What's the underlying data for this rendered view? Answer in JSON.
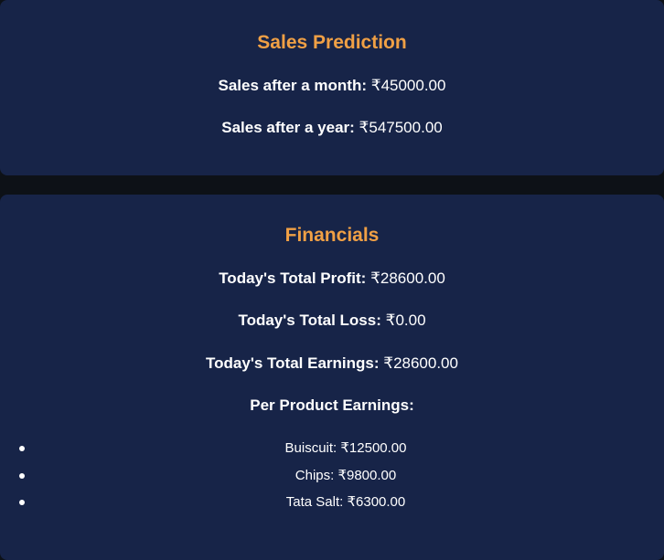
{
  "sales_prediction": {
    "title": "Sales Prediction",
    "month_label": "Sales after a month:",
    "month_value": "₹45000.00",
    "year_label": "Sales after a year:",
    "year_value": "₹547500.00"
  },
  "financials": {
    "title": "Financials",
    "profit_label": "Today's Total Profit:",
    "profit_value": "₹28600.00",
    "loss_label": "Today's Total Loss:",
    "loss_value": "₹0.00",
    "earnings_label": "Today's Total Earnings:",
    "earnings_value": "₹28600.00",
    "per_product_label": "Per Product Earnings:",
    "products": [
      {
        "text": "Buiscuit: ₹12500.00"
      },
      {
        "text": "Chips: ₹9800.00"
      },
      {
        "text": "Tata Salt: ₹6300.00"
      }
    ]
  },
  "colors": {
    "card_bg": "#172448",
    "page_bg": "#0d1117",
    "title": "#f0a045",
    "text": "#ffffff"
  }
}
